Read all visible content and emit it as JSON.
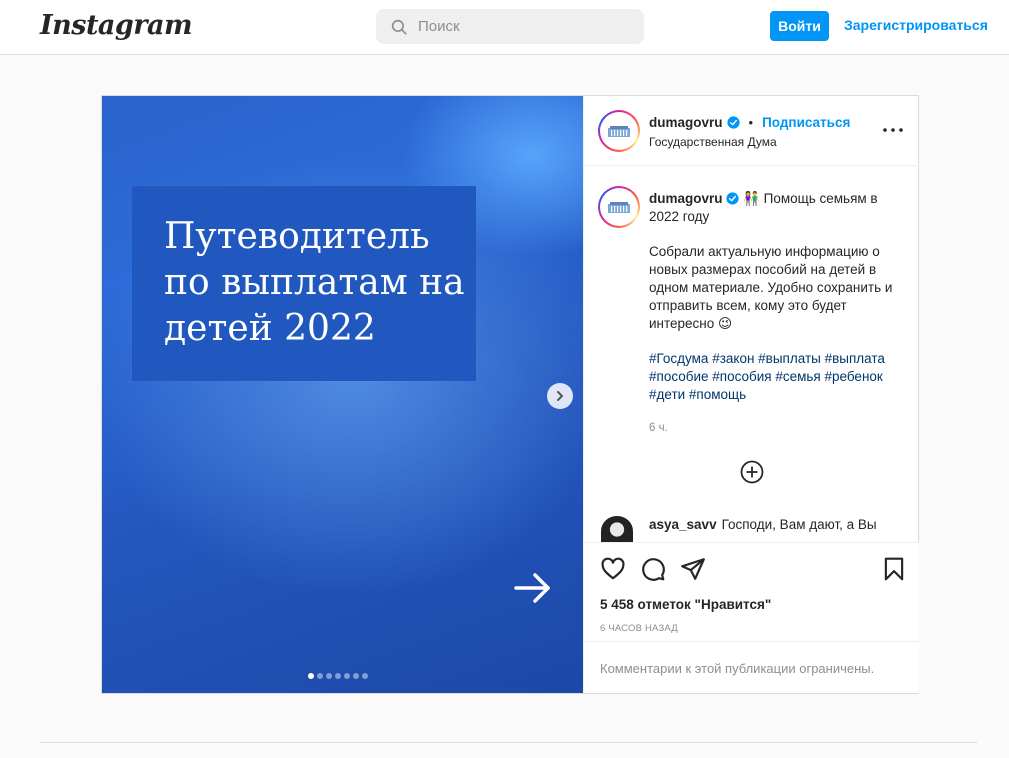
{
  "header": {
    "logo": "Instagram",
    "search_placeholder": "Поиск",
    "login_label": "Войти",
    "signup_label": "Зарегистрироваться"
  },
  "post": {
    "media": {
      "title": "Путеводитель по выплатам на детей 2022",
      "slide_count": 7,
      "active_slide": 1
    },
    "author": {
      "username": "dumagovru",
      "separator": "•",
      "follow_label": "Подписаться",
      "full_name": "Государственная Дума"
    },
    "caption": {
      "username": "dumagovru",
      "emoji": "👫",
      "line1": "Помощь семьям в 2022 году",
      "body": "Собрали актуальную информацию о новых размерах пособий на детей в одном материале. Удобно сохранить и отправить всем, кому это будет интересно 😉",
      "hashtags": "#Госдума #закон #выплаты #выплата #пособие #пособия #семья #ребенок #дети #помощь",
      "time": "6 ч."
    },
    "comment": {
      "username": "asya_savv",
      "text": "Господи, Вам дают, а Вы"
    },
    "likes": "5 458 отметок \"Нравится\"",
    "posted": "6 ЧАСОВ НАЗАД",
    "comments_restricted": "Комментарии к этой публикации ограничены."
  },
  "colors": {
    "accent": "#0095f6",
    "hashtag": "#00376b",
    "muted": "#8e8e8e",
    "border": "#dbdbdb"
  }
}
